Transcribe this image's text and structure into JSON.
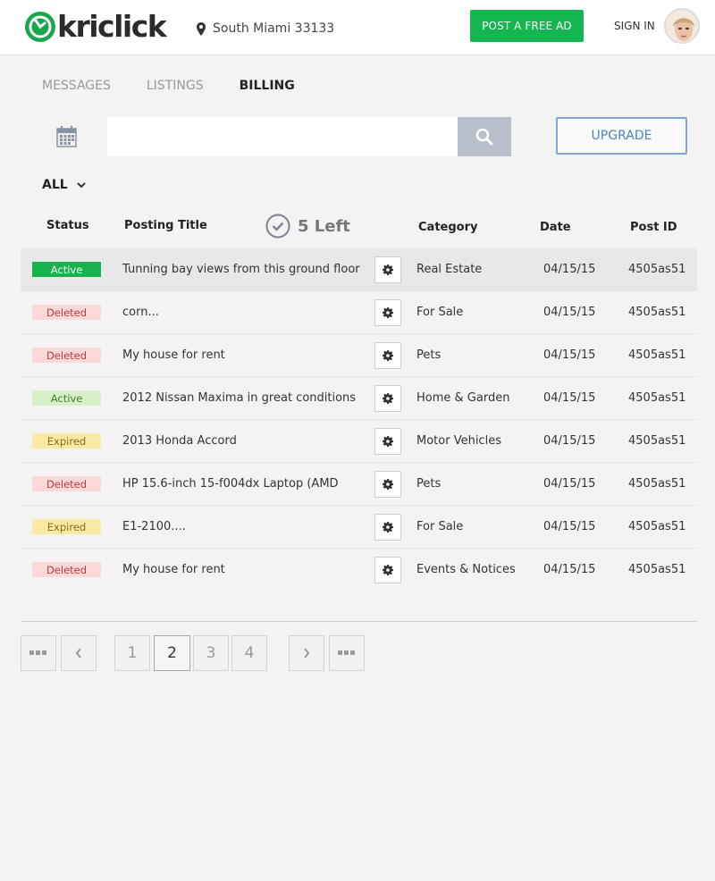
{
  "header": {
    "brand": "kriclick",
    "location": "South Miami 33133",
    "post_ad": "POST A FREE AD",
    "sign_in": "SIGN IN"
  },
  "tabs": [
    {
      "label": "MESSAGES"
    },
    {
      "label": "LISTINGS"
    },
    {
      "label": "BILLING"
    }
  ],
  "search": {
    "value": "",
    "placeholder": ""
  },
  "upgrade": "UPGRADE",
  "filter": {
    "selected": "ALL"
  },
  "table": {
    "headers": {
      "status": "Status",
      "title": "Posting Title",
      "left": "5 Left",
      "category": "Category",
      "date": "Date",
      "post_id": "Post ID"
    },
    "rows": [
      {
        "status": "Active",
        "title": "Tunning bay views from this ground floor",
        "category": "Real Estate",
        "date": "04/15/15",
        "post_id": "4505as51"
      },
      {
        "status": "Deleted",
        "title": "corn...",
        "category": "For Sale",
        "date": "04/15/15",
        "post_id": "4505as51"
      },
      {
        "status": "Deleted",
        "title": "My house for rent",
        "category": "Pets",
        "date": "04/15/15",
        "post_id": "4505as51"
      },
      {
        "status": "Active",
        "title": "2012 Nissan Maxima in great conditions",
        "category": "Home & Garden",
        "date": "04/15/15",
        "post_id": "4505as51"
      },
      {
        "status": "Expired",
        "title": "2013 Honda Accord",
        "category": "Motor Vehicles",
        "date": "04/15/15",
        "post_id": "4505as51"
      },
      {
        "status": "Deleted",
        "title": "HP 15.6-inch 15-f004dx Laptop (AMD",
        "category": "Pets",
        "date": "04/15/15",
        "post_id": "4505as51"
      },
      {
        "status": "Expired",
        "title": "E1-2100....",
        "category": "For Sale",
        "date": "04/15/15",
        "post_id": "4505as51"
      },
      {
        "status": "Deleted",
        "title": "My house for rent",
        "category": "Events & Notices",
        "date": "04/15/15",
        "post_id": "4505as51"
      }
    ]
  },
  "pagination": {
    "pages": [
      "1",
      "2",
      "3",
      "4"
    ],
    "current": "2"
  },
  "colors": {
    "brand_green": "#14b650",
    "active_strong": "#16b34c",
    "deleted_bg": "#fbd9d9",
    "expired_bg": "#fbeaa4",
    "upgrade_blue": "#4d84c4"
  }
}
